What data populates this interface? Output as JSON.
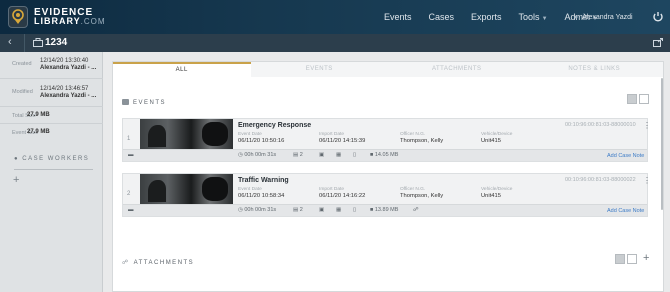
{
  "header": {
    "logo_line1": "EVIDENCE",
    "logo_line2": "LIBRARY",
    "logo_line2_suffix": ".COM",
    "nav": [
      {
        "label": "Events"
      },
      {
        "label": "Cases"
      },
      {
        "label": "Exports"
      },
      {
        "label": "Tools",
        "has_menu": true
      },
      {
        "label": "Admin",
        "has_menu": true
      }
    ],
    "user_name": "Alexandra Yazdi"
  },
  "case": {
    "title": "1234"
  },
  "sidebar": {
    "created_label": "Created",
    "created_date": "12/14/20 13:30:40",
    "created_by": "Alexandra Yazdi - ...",
    "modified_label": "Modified",
    "modified_date": "12/14/20 13:46:57",
    "modified_by": "Alexandra Yazdi - ...",
    "total_size_label": "Total Size",
    "total_size": "27.9 MB",
    "event_size_label": "Event Size",
    "event_size": "27.9 MB",
    "case_workers_title": "CASE WORKERS"
  },
  "tabs": [
    {
      "label": "ALL",
      "active": true
    },
    {
      "label": "EVENTS",
      "active": false
    },
    {
      "label": "ATTACHMENTS",
      "active": false
    },
    {
      "label": "NOTES & LINKS",
      "active": false
    }
  ],
  "events_section_title": "EVENTS",
  "attachments_section_title": "ATTACHMENTS",
  "field_labels": {
    "event_date": "Event Date",
    "import_date": "Import Date",
    "officer": "Officer N.G.",
    "vehicle": "Vehicle/Device"
  },
  "events": [
    {
      "index": "1",
      "title": "Emergency Response",
      "id": "00:10:96:00:81:03-88000010",
      "event_date": "06/11/20 10:50:16",
      "import_date": "06/11/20 14:15:39",
      "officer": "Thompson, Kelly",
      "vehicle": "Unit415",
      "duration": "00h 00m 31s",
      "camera_count": "2",
      "file_size": "14.05 MB",
      "add_note": "Add Case Note"
    },
    {
      "index": "2",
      "title": "Traffic Warning",
      "id": "00:10:96:00:81:03-88000022",
      "event_date": "06/11/20 10:58:34",
      "import_date": "06/11/20 14:16:22",
      "officer": "Thompson, Kelly",
      "vehicle": "Unit415",
      "duration": "00h 00m 31s",
      "camera_count": "2",
      "file_size": "13.89 MB",
      "add_note": "Add Case Note"
    }
  ],
  "colors": {
    "header_bg": "#0d2a40",
    "titlebar_bg": "#2c3e4c",
    "active_tab_accent": "#c9a24a",
    "link": "#3d7cc7"
  }
}
